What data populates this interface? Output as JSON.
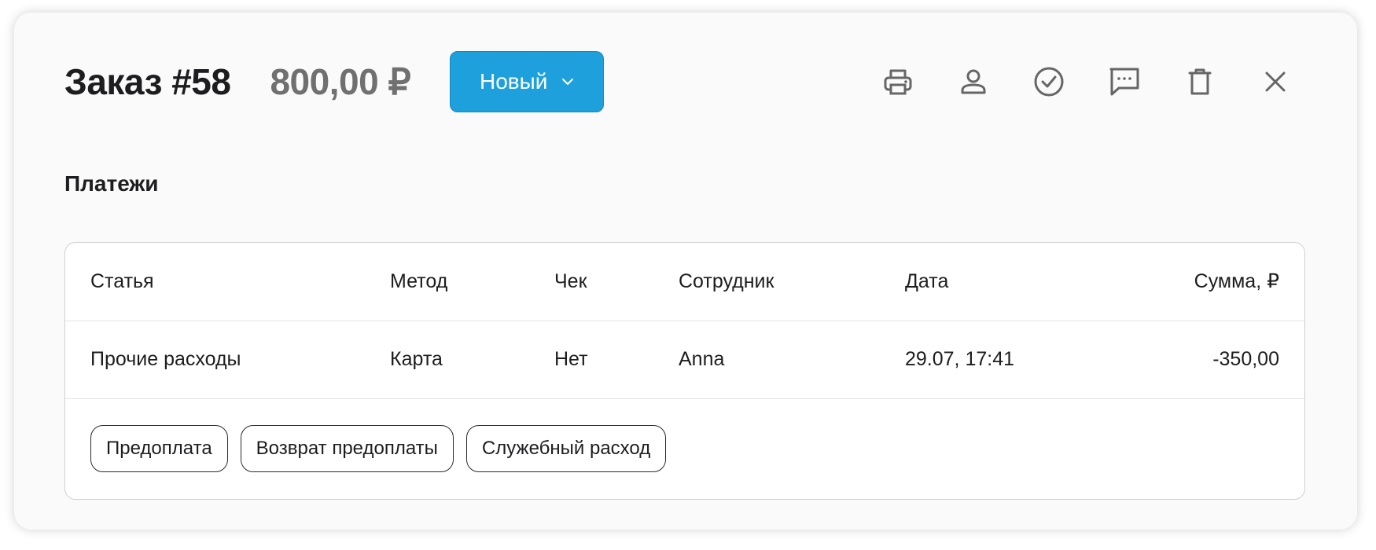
{
  "order": {
    "title": "Заказ #58",
    "amount": "800,00 ₽",
    "status_label": "Новый"
  },
  "toolbar": {
    "icons": [
      "printer-icon",
      "user-icon",
      "check-circle-icon",
      "comment-icon",
      "trash-icon",
      "close-icon"
    ]
  },
  "colors": {
    "accent": "#1ea0dc",
    "amount_gray": "#707070"
  },
  "payments": {
    "section_title": "Платежи",
    "columns": [
      "Статья",
      "Метод",
      "Чек",
      "Сотрудник",
      "Дата",
      "Сумма, ₽"
    ],
    "rows": [
      [
        "Прочие расходы",
        "Карта",
        "Нет",
        "Anna",
        "29.07, 17:41",
        "-350,00"
      ]
    ],
    "actions": [
      "Предоплата",
      "Возврат предоплаты",
      "Служебный расход"
    ]
  }
}
